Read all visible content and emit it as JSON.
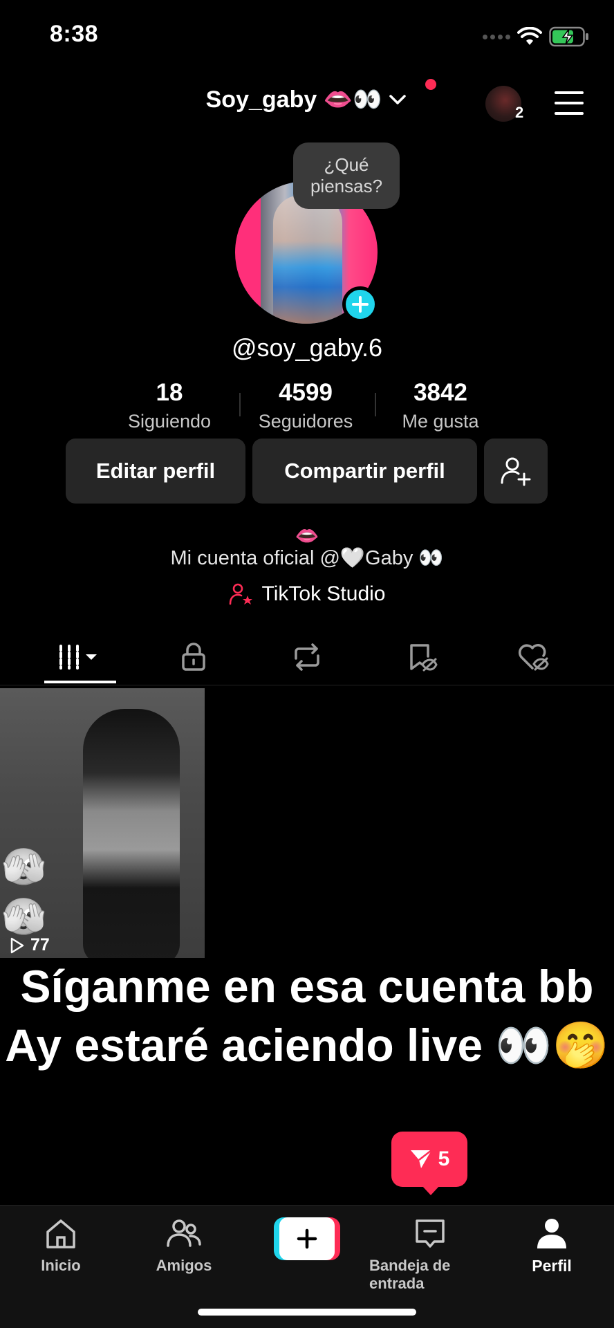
{
  "status_bar": {
    "time": "8:38"
  },
  "header": {
    "account_name": "Soy_gaby 👄👀",
    "followers_badge_count": "2"
  },
  "profile": {
    "thought_bubble": "¿Qué piensas?",
    "username": "@soy_gaby.6",
    "stats": [
      {
        "value": "18",
        "label": "Siguiendo"
      },
      {
        "value": "4599",
        "label": "Seguidores"
      },
      {
        "value": "3842",
        "label": "Me gusta"
      }
    ],
    "edit_button": "Editar perfil",
    "share_button": "Compartir perfil",
    "bio_emoji": "👄",
    "bio": "Mi cuenta oficial @🤍Gaby 👀",
    "studio_link": "TikTok Studio"
  },
  "video": {
    "views": "77"
  },
  "caption": {
    "line1": "Síganme en esa cuenta bb",
    "line2": "Ay estaré aciendo live 👀🤭"
  },
  "inbox_notification": {
    "count": "5"
  },
  "bottom_nav": {
    "home": "Inicio",
    "friends": "Amigos",
    "inbox": "Bandeja de entrada",
    "profile": "Perfil"
  },
  "colors": {
    "accent_red": "#fe2c55",
    "accent_cyan": "#20d5ec",
    "button_bg": "#262626"
  }
}
